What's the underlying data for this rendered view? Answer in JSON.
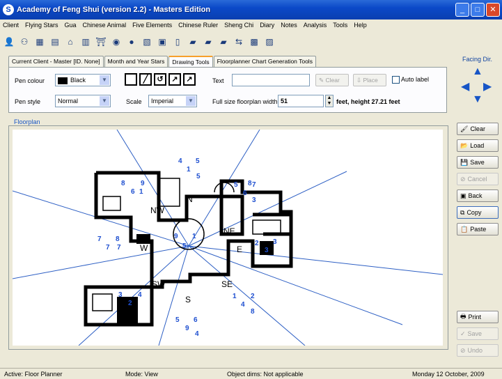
{
  "window": {
    "title": "Academy of Feng Shui (version 2.2) - Masters Edition",
    "app_icon": "S"
  },
  "menu": [
    "Client",
    "Flying Stars",
    "Gua",
    "Chinese Animal",
    "Five Elements",
    "Chinese Ruler",
    "Sheng Chi",
    "Diary",
    "Notes",
    "Analysis",
    "Tools",
    "Help"
  ],
  "toolbar_icons": [
    "person-icon",
    "people-icon",
    "grid-icon",
    "chart-icon",
    "house-icon",
    "book-icon",
    "gate-icon",
    "compass-icon",
    "circle-icon",
    "table-icon",
    "calendar-icon",
    "page-icon",
    "layers-icon",
    "layers2-icon",
    "layers3-icon",
    "arrows-icon",
    "map-icon",
    "form-icon"
  ],
  "tabs": [
    "Current Client - Master [ID. None]",
    "Month and Year Stars",
    "Drawing Tools",
    "Floorplanner Chart Generation Tools"
  ],
  "active_tab": "Drawing Tools",
  "drawing": {
    "pen_colour_label": "Pen colour",
    "pen_colour_value": "Black",
    "pen_style_label": "Pen style",
    "pen_style_value": "Normal",
    "scale_label": "Scale",
    "scale_value": "Imperial",
    "text_label": "Text",
    "text_value": "",
    "clear_label": "Clear",
    "place_label": "Place",
    "auto_label": "Auto label",
    "width_label": "Full size floorplan width",
    "width_value": "51",
    "width_suffix": "feet, height 27.21 feet"
  },
  "facing": {
    "label": "Facing Dir."
  },
  "floorplan_title": "Floorplan",
  "sectors": [
    "N",
    "NE",
    "E",
    "SE",
    "S",
    "SW",
    "W",
    "NW"
  ],
  "star_numbers": [
    {
      "t": "4"
    },
    {
      "t": "5"
    },
    {
      "t": "1"
    },
    {
      "t": "5"
    },
    {
      "t": "8"
    },
    {
      "t": "9"
    },
    {
      "t": "6"
    },
    {
      "t": "1"
    },
    {
      "t": "5"
    },
    {
      "t": "6"
    },
    {
      "t": "7"
    },
    {
      "t": "8"
    },
    {
      "t": "3"
    },
    {
      "t": "7"
    },
    {
      "t": "8"
    },
    {
      "t": "7"
    },
    {
      "t": "7"
    },
    {
      "t": "9"
    },
    {
      "t": "5"
    },
    {
      "t": "1"
    },
    {
      "t": "2"
    },
    {
      "t": "3"
    },
    {
      "t": "3"
    },
    {
      "t": "3"
    },
    {
      "t": "4"
    },
    {
      "t": "2"
    },
    {
      "t": "1"
    },
    {
      "t": "2"
    },
    {
      "t": "4"
    },
    {
      "t": "8"
    },
    {
      "t": "5"
    },
    {
      "t": "6"
    },
    {
      "t": "9"
    },
    {
      "t": "4"
    }
  ],
  "right_buttons": [
    {
      "label": "Clear",
      "icon": "brush-icon",
      "enabled": true
    },
    {
      "label": "Load",
      "icon": "load-icon",
      "enabled": true
    },
    {
      "label": "Save",
      "icon": "save-icon",
      "enabled": true
    },
    {
      "label": "Cancel",
      "icon": "cancel-icon",
      "enabled": false
    },
    {
      "label": "Back",
      "icon": "back-icon",
      "enabled": true
    },
    {
      "label": "Copy",
      "icon": "copy-icon",
      "enabled": true
    },
    {
      "label": "Paste",
      "icon": "paste-icon",
      "enabled": true
    },
    {
      "label": "Print",
      "icon": "print-icon",
      "enabled": true
    },
    {
      "label": "Save",
      "icon": "check-icon",
      "enabled": false
    },
    {
      "label": "Undo",
      "icon": "undo-icon",
      "enabled": false
    }
  ],
  "status": {
    "active": "Active: Floor Planner",
    "mode": "Mode: View",
    "object": "Object dims: Not applicable",
    "date": "Monday 12 October, 2009"
  },
  "colors": {
    "accent": "#1755C6",
    "lines": "#2D5FC4",
    "stars": "#1E4FD0"
  }
}
